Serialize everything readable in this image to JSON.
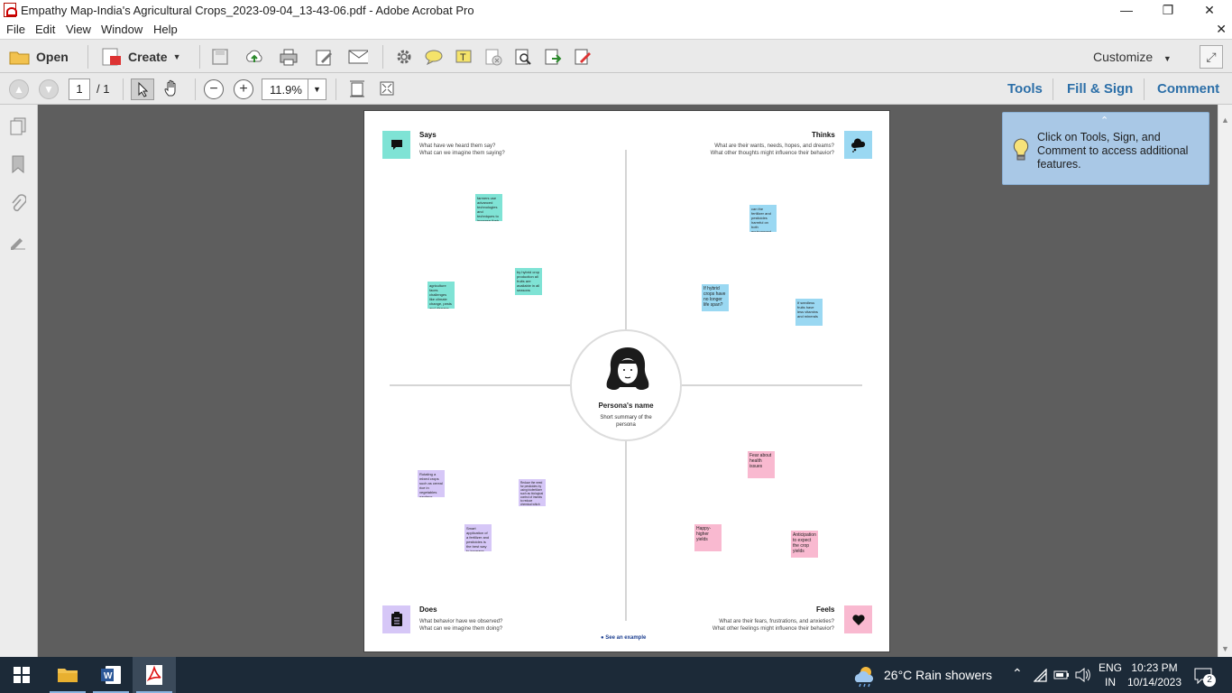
{
  "window": {
    "title": "Empathy Map-India's Agricultural Crops_2023-09-04_13-43-06.pdf - Adobe Acrobat Pro"
  },
  "menu": {
    "items": [
      "File",
      "Edit",
      "View",
      "Window",
      "Help"
    ]
  },
  "toolbar": {
    "open_label": "Open",
    "create_label": "Create",
    "customize_label": "Customize",
    "icons": [
      "save-icon",
      "upload-cloud-icon",
      "print-icon",
      "edit-icon",
      "email-icon",
      "gear-icon",
      "comment-icon",
      "highlight-icon",
      "delete-icon",
      "search-icon",
      "export-icon",
      "sign-icon"
    ]
  },
  "navigation": {
    "current_page": "1",
    "total_pages": "/ 1",
    "zoom": "11.9%",
    "tools_link": "Tools",
    "fill_sign_link": "Fill & Sign",
    "comment_link": "Comment"
  },
  "document": {
    "says": {
      "title": "Says",
      "line1": "What have we heard them say?",
      "line2": "What can we imagine them saying?"
    },
    "thinks": {
      "title": "Thinks",
      "line1": "What are their wants, needs, hopes, and dreams?",
      "line2": "What other thoughts might influence their behavior?"
    },
    "does": {
      "title": "Does",
      "line1": "What behavior have we observed?",
      "line2": "What can we imagine them doing?"
    },
    "feels": {
      "title": "Feels",
      "line1": "What are their fears, frustrations, and anxieties?",
      "line2": "What other feelings might influence their behavior?"
    },
    "persona": {
      "name": "Persona's name",
      "summary": "Short summary of the persona"
    },
    "see_example": "See an example",
    "stickies": {
      "says1": "farmers use advanced technologies and techniques to increase their crop yield to maximize production",
      "says2": "by hybrid crop production all fruits are available in all seasons",
      "says3": "agriculture faces challenges like climate change, pests and disease",
      "thinks1": "can the fertilizer and pesticides harmful on both environment and people?",
      "thinks2": "If hybrid crops have no longer life span?",
      "thinks3": "If seedless fruits have less vitamins and minerals",
      "does1": "Rotating a mixed crops such as cereal rice in vegetables gardens reduces soil erosion",
      "does2": "Reduce the need for pesticides by using biofertilizer such as biological control of insects to reduce chemical which are bio-friendly fertilizers",
      "does3": "Smart application of a fertilizer and pesticides is the best way to increase crop production",
      "feels1": "Fear about health issues",
      "feels2": "Happy- higher yields",
      "feels3": "Anticipation to expect the crop yields"
    },
    "colors": {
      "says": "#7fe3d5",
      "thinks": "#9ad8f2",
      "does": "#d6c7f7",
      "feels": "#f9b9d0"
    }
  },
  "callout": {
    "text": "Click on Tools, Sign, and Comment to access additional features."
  },
  "taskbar": {
    "weather": "26°C  Rain showers",
    "lang_line1": "ENG",
    "lang_line2": "IN",
    "time": "10:23 PM",
    "date": "10/14/2023",
    "notification_count": "2"
  }
}
